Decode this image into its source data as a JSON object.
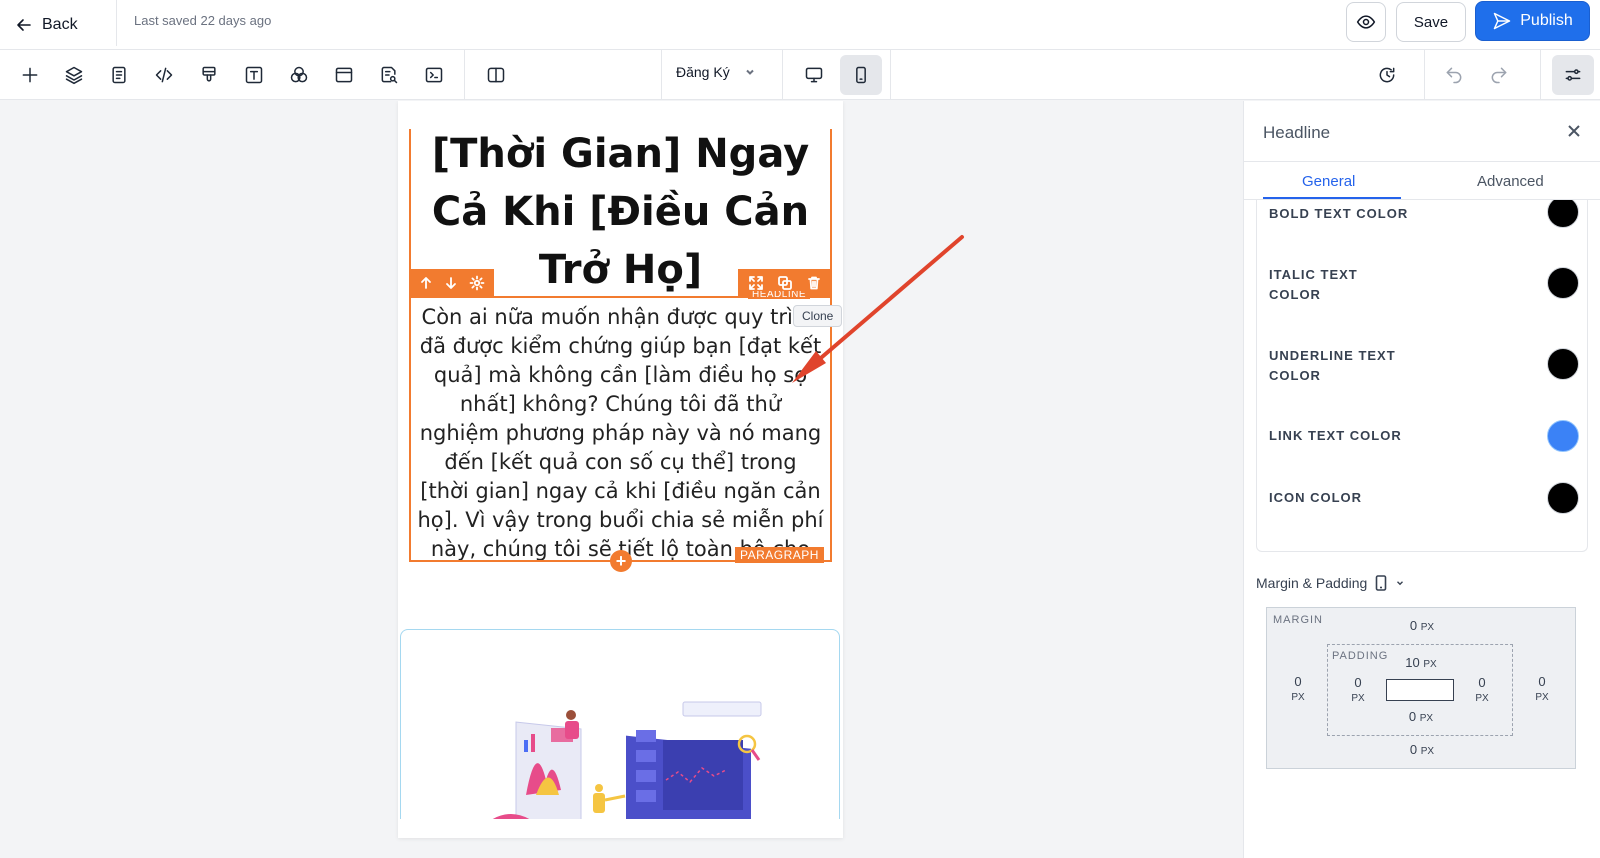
{
  "topbar": {
    "back_label": "Back",
    "last_saved": "Last saved 22 days ago",
    "save_label": "Save",
    "publish_label": "Publish"
  },
  "toolbar": {
    "page_select": "Đăng Ký"
  },
  "canvas": {
    "headline": "[Thời Gian] Ngay Cả Khi [Điều Cản Trở Họ]",
    "headline_tag": "HEADLINE",
    "paragraph": "Còn ai nữa muốn nhận được quy trình đã được kiểm chứng giúp bạn [đạt kết quả] mà không cần [làm điều họ sợ nhất] không? Chúng tôi đã thử nghiệm phương pháp này và nó mang đến [kết quả con số cụ thể] trong [thời gian] ngay cả khi [điều ngăn cản họ]. Vì vậy trong buổi chia sẻ miễn phí này, chúng tôi sẽ tiết lộ toàn bộ cho bạn",
    "paragraph_tag": "PARAGRAPH",
    "tooltip": "Clone",
    "add_symbol": "+"
  },
  "panel": {
    "title": "Headline",
    "tabs": [
      {
        "label": "General",
        "active": true
      },
      {
        "label": "Advanced",
        "active": false
      }
    ],
    "colors": [
      {
        "label": "BOLD TEXT COLOR",
        "value": "#000000"
      },
      {
        "label": "ITALIC TEXT COLOR",
        "value": "#000000"
      },
      {
        "label": "UNDERLINE TEXT COLOR",
        "value": "#000000"
      },
      {
        "label": "LINK TEXT COLOR",
        "value": "#3b82f6"
      },
      {
        "label": "ICON COLOR",
        "value": "#000000"
      }
    ],
    "margin_padding_label": "Margin & Padding",
    "margin": {
      "label": "MARGIN",
      "top": "0",
      "right": "0",
      "bottom": "0",
      "left": "0",
      "unit": "PX"
    },
    "padding": {
      "label": "PADDING",
      "top": "10",
      "right": "0",
      "bottom": "0",
      "left": "0",
      "unit": "PX"
    }
  },
  "colors": {
    "accent": "#1f6feb",
    "element_outline": "#f27b2f",
    "annotation_arrow": "#e0442c"
  }
}
